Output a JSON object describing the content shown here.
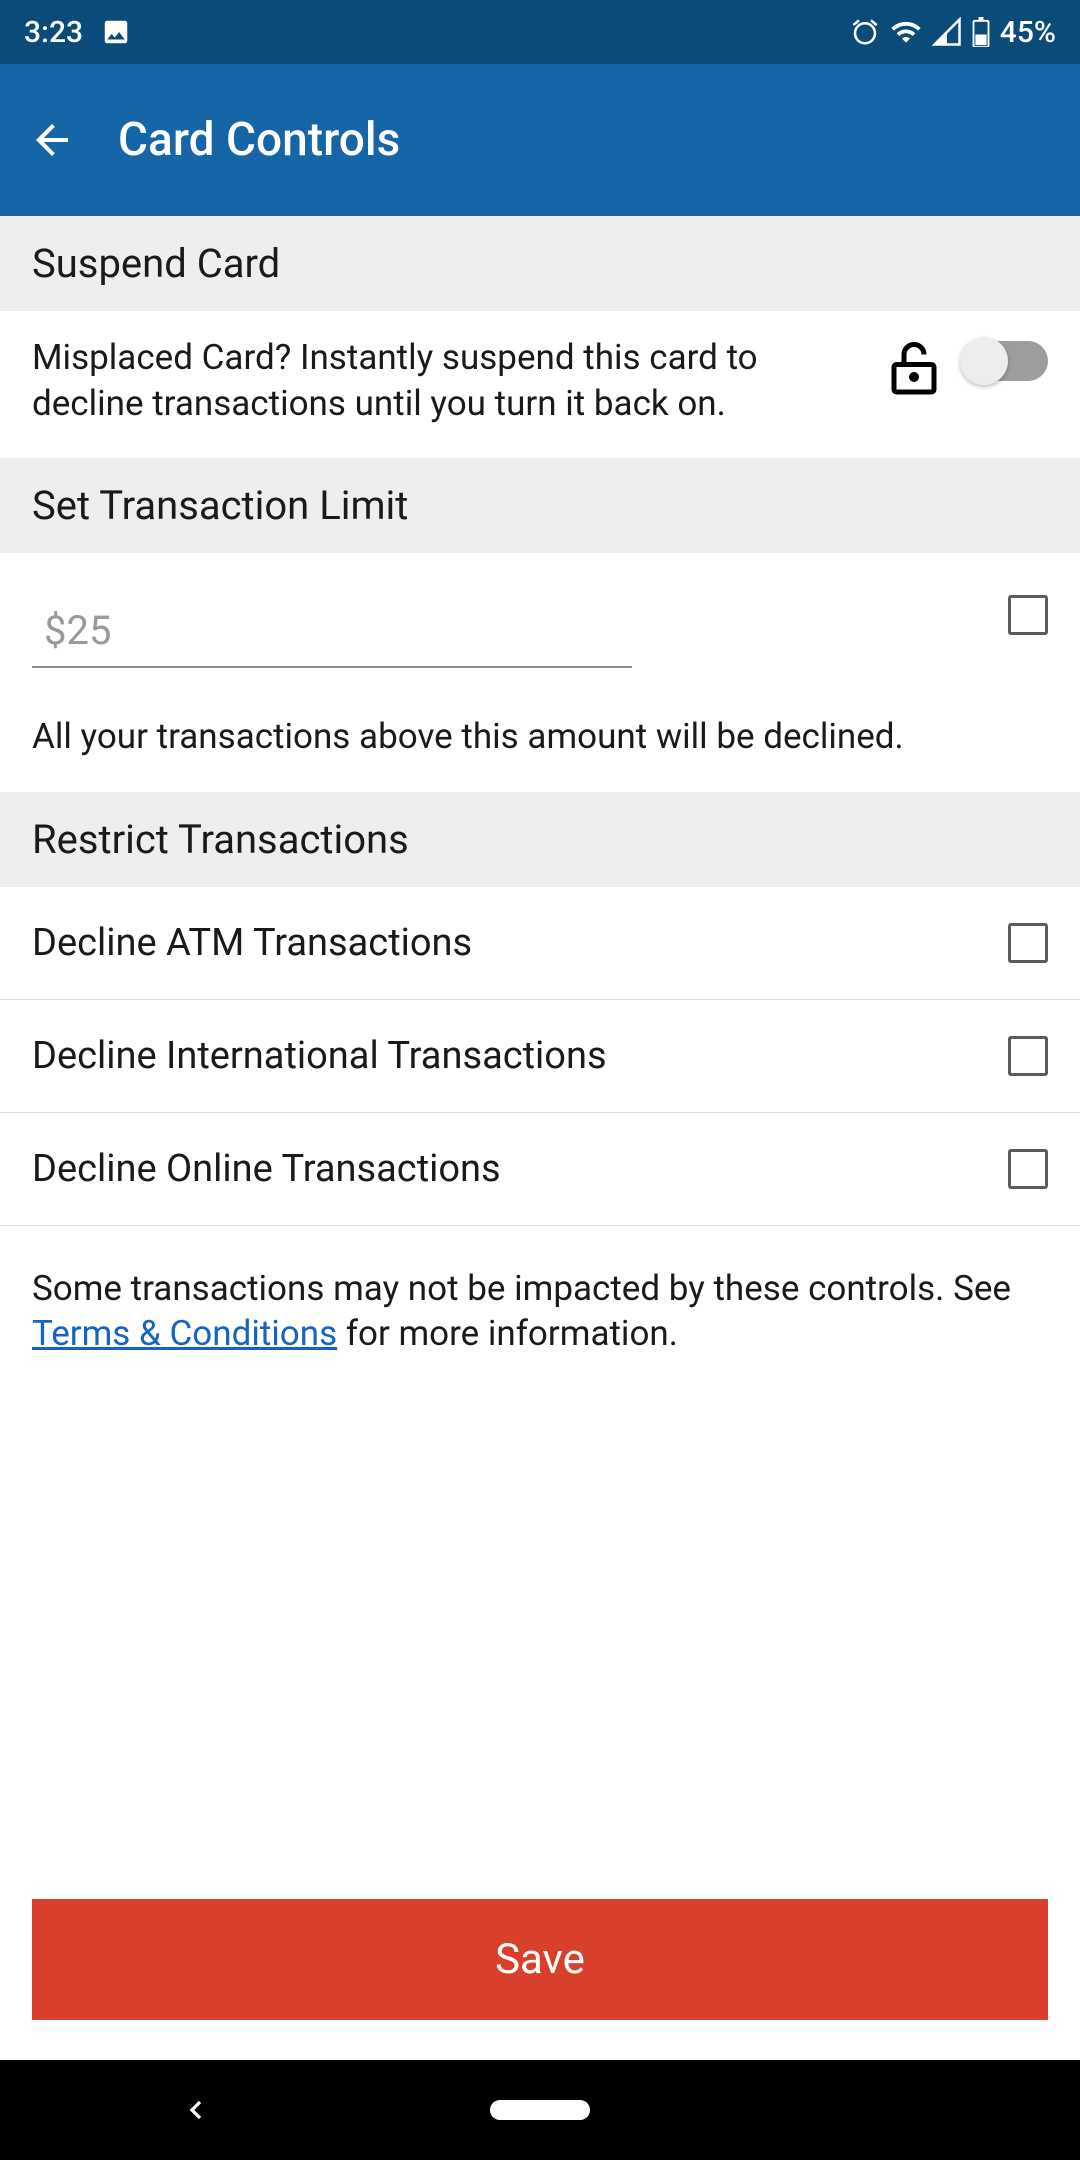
{
  "status": {
    "time": "3:23",
    "battery": "45%"
  },
  "header": {
    "title": "Card Controls"
  },
  "suspend": {
    "heading": "Suspend Card",
    "description": "Misplaced Card? Instantly suspend this card to decline transactions until you turn it back on."
  },
  "limit": {
    "heading": "Set Transaction Limit",
    "placeholder": "$25",
    "note": "All your transactions above this amount will be declined."
  },
  "restrict": {
    "heading": "Restrict Transactions",
    "items": [
      {
        "label": "Decline ATM Transactions"
      },
      {
        "label": "Decline International Transactions"
      },
      {
        "label": "Decline Online Transactions"
      }
    ]
  },
  "disclaimer": {
    "before": "Some transactions may not be impacted by these controls. See ",
    "link": "Terms & Conditions",
    "after": " for more information."
  },
  "save_label": "Save"
}
